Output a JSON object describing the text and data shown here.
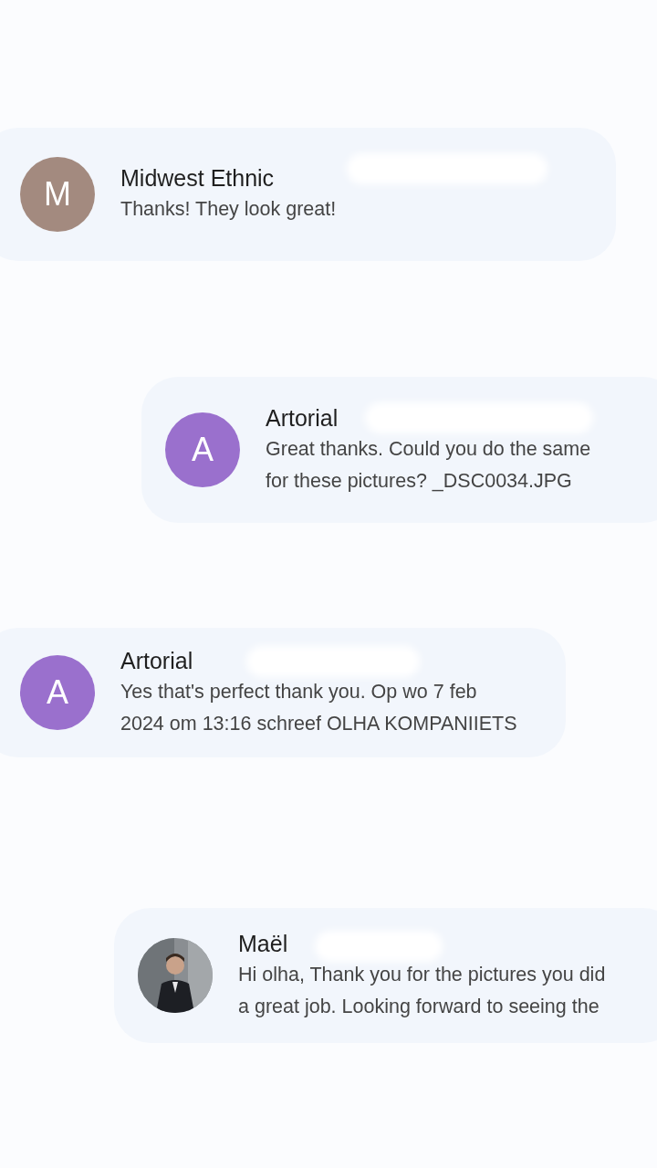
{
  "messages": [
    {
      "sender": "Midwest Ethnic",
      "avatar": {
        "kind": "letter",
        "letter": "M",
        "color": "#a38a7f"
      },
      "lines": [
        "Thanks! They look great!"
      ]
    },
    {
      "sender": "Artorial",
      "avatar": {
        "kind": "letter",
        "letter": "A",
        "color": "#9a70cd"
      },
      "lines": [
        "Great thanks. Could you do the same",
        "for these pictures? _DSC0034.JPG"
      ]
    },
    {
      "sender": "Artorial",
      "avatar": {
        "kind": "letter",
        "letter": "A",
        "color": "#9a70cd"
      },
      "lines": [
        "Yes that's perfect thank you. Op wo 7 feb",
        "2024 om 13:16 schreef OLHA KOMPANIIETS"
      ]
    },
    {
      "sender": "Maël",
      "lines": [
        "Hi olha, Thank you for the pictures you did",
        "a great job. Looking forward to seeing the"
      ]
    }
  ]
}
